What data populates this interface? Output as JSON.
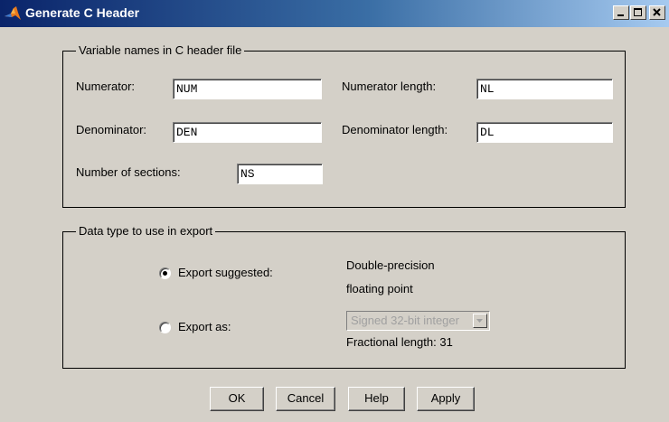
{
  "window": {
    "title": "Generate C Header",
    "controls": [
      "minimize",
      "maximize",
      "close"
    ]
  },
  "var_group": {
    "legend": "Variable names in C header file",
    "numerator": {
      "label": "Numerator:",
      "value": "NUM"
    },
    "numerator_length": {
      "label": "Numerator length:",
      "value": "NL"
    },
    "denominator": {
      "label": "Denominator:",
      "value": "DEN"
    },
    "denominator_length": {
      "label": "Denominator length:",
      "value": "DL"
    },
    "sections": {
      "label": "Number of sections:",
      "value": "NS"
    }
  },
  "data_group": {
    "legend": "Data type to use in export",
    "suggested": {
      "label": "Export suggested:",
      "selected": true,
      "type_line1": "Double-precision",
      "type_line2": "floating point"
    },
    "export_as": {
      "label": "Export as:",
      "selected": false,
      "dropdown_value": "Signed 32-bit integer",
      "dropdown_enabled": false,
      "fractional_length": "Fractional length:  31"
    }
  },
  "buttons": {
    "ok": "OK",
    "cancel": "Cancel",
    "help": "Help",
    "apply": "Apply"
  },
  "icons": {
    "app": "matlab-icon",
    "dropdown": "chevron-down-icon"
  }
}
